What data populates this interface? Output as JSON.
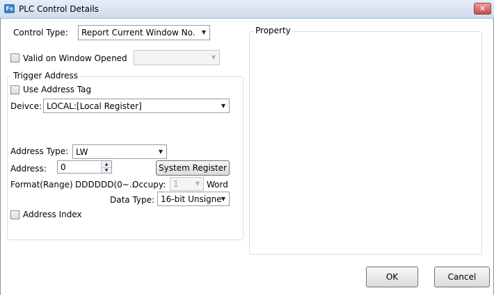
{
  "window": {
    "title": "PLC Control Details",
    "icon_text": "Fs",
    "close_glyph": "✕"
  },
  "control_type": {
    "label": "Control Type:",
    "value": "Report Current Window No."
  },
  "valid_on_window_opened": {
    "label": "Valid on Window Opened",
    "checked": false,
    "combo_value": ""
  },
  "trigger_address": {
    "group_title": "Trigger Address",
    "use_address_tag_label": "Use Address Tag",
    "device_label": "Deivce:",
    "device_value": "LOCAL:[Local Register]",
    "address_type_label": "Address Type:",
    "address_type_value": "LW",
    "address_label": "Address:",
    "address_value": "0",
    "system_register_button": "System Register",
    "format_label": "Format(Range)",
    "format_value": "DDDDDD(0~...",
    "occupy_label": "Occupy:",
    "occupy_value": "1",
    "word_label": "Word",
    "data_type_label": "Data Type:",
    "data_type_value": "16-bit Unsigne",
    "address_index_label": "Address Index"
  },
  "property": {
    "group_title": "Property"
  },
  "buttons": {
    "ok": "OK",
    "cancel": "Cancel"
  },
  "icons": {
    "dropdown": "chevron-down-icon",
    "spin_up": "up-arrow-icon",
    "spin_down": "down-arrow-icon",
    "close": "close-icon"
  }
}
